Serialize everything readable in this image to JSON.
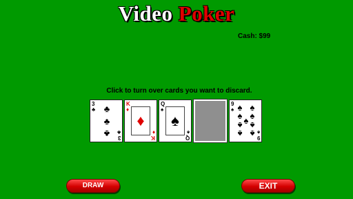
{
  "title": {
    "word1": "Video",
    "word2": "Poker"
  },
  "cash_label": "Cash: $99",
  "instructions": "Click to turn over cards you want to discard.",
  "cards": [
    {
      "rank": "3",
      "suit": "clubs",
      "suit_symbol": "♣",
      "color": "#000000",
      "face_up": true
    },
    {
      "rank": "K",
      "suit": "diamonds",
      "suit_symbol": "♦",
      "color": "#e00000",
      "face_up": true
    },
    {
      "rank": "Q",
      "suit": "spades",
      "suit_symbol": "♠",
      "color": "#000000",
      "face_up": true
    },
    {
      "rank": "",
      "suit": "",
      "suit_symbol": "",
      "color": "#8f8f8f",
      "face_up": false
    },
    {
      "rank": "9",
      "suit": "spades",
      "suit_symbol": "♠",
      "color": "#000000",
      "face_up": true
    }
  ],
  "buttons": {
    "draw": "DRAW",
    "exit": "EXIT"
  },
  "colors": {
    "felt": "#009a00",
    "button": "#d40000",
    "title_red": "#e00000"
  }
}
